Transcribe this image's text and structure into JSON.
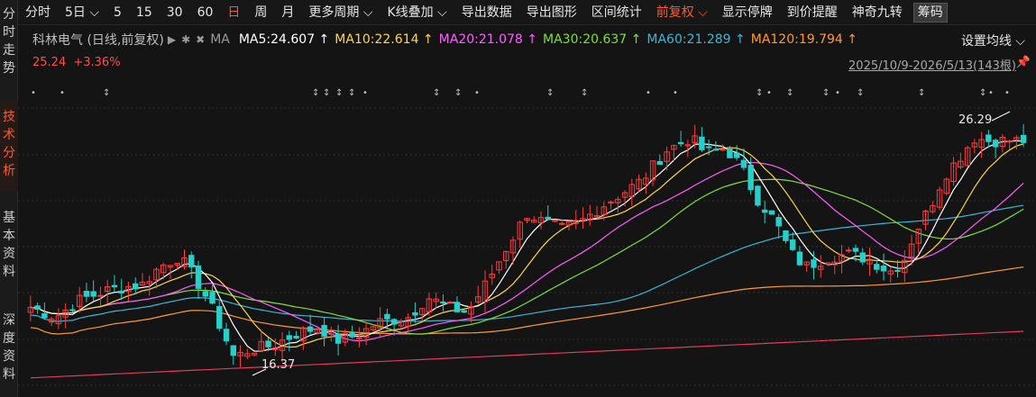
{
  "sidebar": {
    "tabs": [
      {
        "label": "分\n时\n走\n势",
        "active": false
      },
      {
        "label": "技\n术\n分\n析",
        "active": true
      },
      {
        "label": "基\n本\n资\n料",
        "active": false
      },
      {
        "label": "深\n度\n资\n料",
        "active": false
      }
    ]
  },
  "toolbar": {
    "items": [
      {
        "label": "分时"
      },
      {
        "label": "5日 ⌵"
      },
      {
        "label": "5"
      },
      {
        "label": "15"
      },
      {
        "label": "30"
      },
      {
        "label": "60"
      },
      {
        "label": "日",
        "active": true
      },
      {
        "label": "周"
      },
      {
        "label": "月"
      },
      {
        "label": "更多周期 ⌵"
      },
      {
        "label": "K线叠加 ⌵"
      },
      {
        "label": "导出数据"
      },
      {
        "label": "导出图形"
      },
      {
        "label": "区间统计"
      },
      {
        "label": "前复权 ⌵",
        "active": true
      },
      {
        "label": "显示停牌"
      },
      {
        "label": "到价提醒"
      },
      {
        "label": "神奇九转"
      },
      {
        "label": "筹码",
        "boxed": true
      }
    ]
  },
  "indicator": {
    "title": "科林电气 (日线,前复权)",
    "ma_label": "MA",
    "ma5": "MA5:24.607 ↑",
    "ma10": "MA10:22.614 ↑",
    "ma20": "MA20:21.078 ↑",
    "ma30": "MA30:20.637 ↑",
    "ma60": "MA60:21.289 ↑",
    "ma120": "MA120:19.794 ↑",
    "setting": "设置均线 ⌵"
  },
  "quote": {
    "price": "25.24",
    "change": "+3.36%"
  },
  "range_label": "2025/10/9-2026/5/13(143根)",
  "annotations": {
    "high": "26.29",
    "low": "16.37"
  },
  "colors": {
    "up": "#ff3b3b",
    "down": "#26d0c8",
    "ma5": "#ffffff",
    "ma10": "#ffd54a",
    "ma20": "#ff5cff",
    "ma30": "#7ddf3a",
    "ma60": "#39b7d6",
    "ma120": "#ff9a2e",
    "ma250": "#e23b5c"
  },
  "chart_data": {
    "type": "candlestick",
    "count": 143,
    "y_range": [
      15.4,
      27.2
    ],
    "high": 26.29,
    "low": 16.37,
    "grid": true
  }
}
